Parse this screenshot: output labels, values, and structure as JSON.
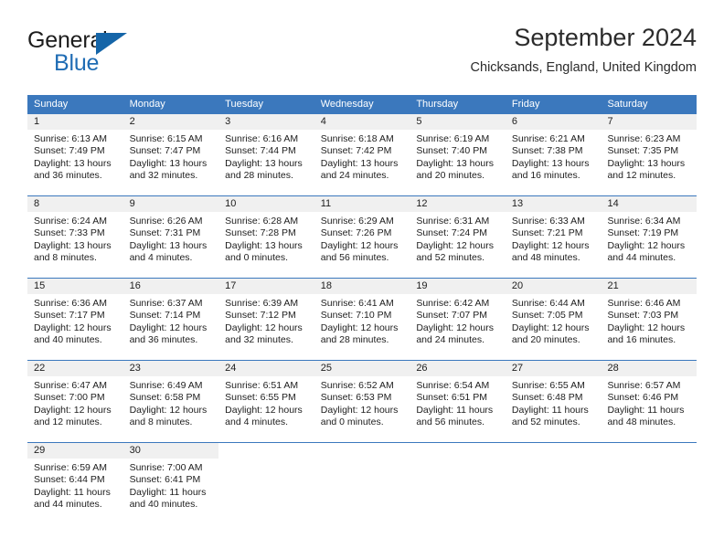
{
  "brand": {
    "line1": "General",
    "line2": "Blue",
    "accent_color": "#1565a8",
    "triangle_icon": "triangle-icon"
  },
  "header": {
    "title": "September 2024",
    "subtitle": "Chicksands, England, United Kingdom"
  },
  "calendar": {
    "header_color": "#3b78bd",
    "daynum_band_color": "#f0f0f0",
    "weekdays": [
      "Sunday",
      "Monday",
      "Tuesday",
      "Wednesday",
      "Thursday",
      "Friday",
      "Saturday"
    ],
    "weeks": [
      [
        {
          "day": "1",
          "sunrise": "Sunrise: 6:13 AM",
          "sunset": "Sunset: 7:49 PM",
          "daylight": "Daylight: 13 hours and 36 minutes."
        },
        {
          "day": "2",
          "sunrise": "Sunrise: 6:15 AM",
          "sunset": "Sunset: 7:47 PM",
          "daylight": "Daylight: 13 hours and 32 minutes."
        },
        {
          "day": "3",
          "sunrise": "Sunrise: 6:16 AM",
          "sunset": "Sunset: 7:44 PM",
          "daylight": "Daylight: 13 hours and 28 minutes."
        },
        {
          "day": "4",
          "sunrise": "Sunrise: 6:18 AM",
          "sunset": "Sunset: 7:42 PM",
          "daylight": "Daylight: 13 hours and 24 minutes."
        },
        {
          "day": "5",
          "sunrise": "Sunrise: 6:19 AM",
          "sunset": "Sunset: 7:40 PM",
          "daylight": "Daylight: 13 hours and 20 minutes."
        },
        {
          "day": "6",
          "sunrise": "Sunrise: 6:21 AM",
          "sunset": "Sunset: 7:38 PM",
          "daylight": "Daylight: 13 hours and 16 minutes."
        },
        {
          "day": "7",
          "sunrise": "Sunrise: 6:23 AM",
          "sunset": "Sunset: 7:35 PM",
          "daylight": "Daylight: 13 hours and 12 minutes."
        }
      ],
      [
        {
          "day": "8",
          "sunrise": "Sunrise: 6:24 AM",
          "sunset": "Sunset: 7:33 PM",
          "daylight": "Daylight: 13 hours and 8 minutes."
        },
        {
          "day": "9",
          "sunrise": "Sunrise: 6:26 AM",
          "sunset": "Sunset: 7:31 PM",
          "daylight": "Daylight: 13 hours and 4 minutes."
        },
        {
          "day": "10",
          "sunrise": "Sunrise: 6:28 AM",
          "sunset": "Sunset: 7:28 PM",
          "daylight": "Daylight: 13 hours and 0 minutes."
        },
        {
          "day": "11",
          "sunrise": "Sunrise: 6:29 AM",
          "sunset": "Sunset: 7:26 PM",
          "daylight": "Daylight: 12 hours and 56 minutes."
        },
        {
          "day": "12",
          "sunrise": "Sunrise: 6:31 AM",
          "sunset": "Sunset: 7:24 PM",
          "daylight": "Daylight: 12 hours and 52 minutes."
        },
        {
          "day": "13",
          "sunrise": "Sunrise: 6:33 AM",
          "sunset": "Sunset: 7:21 PM",
          "daylight": "Daylight: 12 hours and 48 minutes."
        },
        {
          "day": "14",
          "sunrise": "Sunrise: 6:34 AM",
          "sunset": "Sunset: 7:19 PM",
          "daylight": "Daylight: 12 hours and 44 minutes."
        }
      ],
      [
        {
          "day": "15",
          "sunrise": "Sunrise: 6:36 AM",
          "sunset": "Sunset: 7:17 PM",
          "daylight": "Daylight: 12 hours and 40 minutes."
        },
        {
          "day": "16",
          "sunrise": "Sunrise: 6:37 AM",
          "sunset": "Sunset: 7:14 PM",
          "daylight": "Daylight: 12 hours and 36 minutes."
        },
        {
          "day": "17",
          "sunrise": "Sunrise: 6:39 AM",
          "sunset": "Sunset: 7:12 PM",
          "daylight": "Daylight: 12 hours and 32 minutes."
        },
        {
          "day": "18",
          "sunrise": "Sunrise: 6:41 AM",
          "sunset": "Sunset: 7:10 PM",
          "daylight": "Daylight: 12 hours and 28 minutes."
        },
        {
          "day": "19",
          "sunrise": "Sunrise: 6:42 AM",
          "sunset": "Sunset: 7:07 PM",
          "daylight": "Daylight: 12 hours and 24 minutes."
        },
        {
          "day": "20",
          "sunrise": "Sunrise: 6:44 AM",
          "sunset": "Sunset: 7:05 PM",
          "daylight": "Daylight: 12 hours and 20 minutes."
        },
        {
          "day": "21",
          "sunrise": "Sunrise: 6:46 AM",
          "sunset": "Sunset: 7:03 PM",
          "daylight": "Daylight: 12 hours and 16 minutes."
        }
      ],
      [
        {
          "day": "22",
          "sunrise": "Sunrise: 6:47 AM",
          "sunset": "Sunset: 7:00 PM",
          "daylight": "Daylight: 12 hours and 12 minutes."
        },
        {
          "day": "23",
          "sunrise": "Sunrise: 6:49 AM",
          "sunset": "Sunset: 6:58 PM",
          "daylight": "Daylight: 12 hours and 8 minutes."
        },
        {
          "day": "24",
          "sunrise": "Sunrise: 6:51 AM",
          "sunset": "Sunset: 6:55 PM",
          "daylight": "Daylight: 12 hours and 4 minutes."
        },
        {
          "day": "25",
          "sunrise": "Sunrise: 6:52 AM",
          "sunset": "Sunset: 6:53 PM",
          "daylight": "Daylight: 12 hours and 0 minutes."
        },
        {
          "day": "26",
          "sunrise": "Sunrise: 6:54 AM",
          "sunset": "Sunset: 6:51 PM",
          "daylight": "Daylight: 11 hours and 56 minutes."
        },
        {
          "day": "27",
          "sunrise": "Sunrise: 6:55 AM",
          "sunset": "Sunset: 6:48 PM",
          "daylight": "Daylight: 11 hours and 52 minutes."
        },
        {
          "day": "28",
          "sunrise": "Sunrise: 6:57 AM",
          "sunset": "Sunset: 6:46 PM",
          "daylight": "Daylight: 11 hours and 48 minutes."
        }
      ],
      [
        {
          "day": "29",
          "sunrise": "Sunrise: 6:59 AM",
          "sunset": "Sunset: 6:44 PM",
          "daylight": "Daylight: 11 hours and 44 minutes."
        },
        {
          "day": "30",
          "sunrise": "Sunrise: 7:00 AM",
          "sunset": "Sunset: 6:41 PM",
          "daylight": "Daylight: 11 hours and 40 minutes."
        },
        {
          "day": "",
          "sunrise": "",
          "sunset": "",
          "daylight": ""
        },
        {
          "day": "",
          "sunrise": "",
          "sunset": "",
          "daylight": ""
        },
        {
          "day": "",
          "sunrise": "",
          "sunset": "",
          "daylight": ""
        },
        {
          "day": "",
          "sunrise": "",
          "sunset": "",
          "daylight": ""
        },
        {
          "day": "",
          "sunrise": "",
          "sunset": "",
          "daylight": ""
        }
      ]
    ]
  }
}
